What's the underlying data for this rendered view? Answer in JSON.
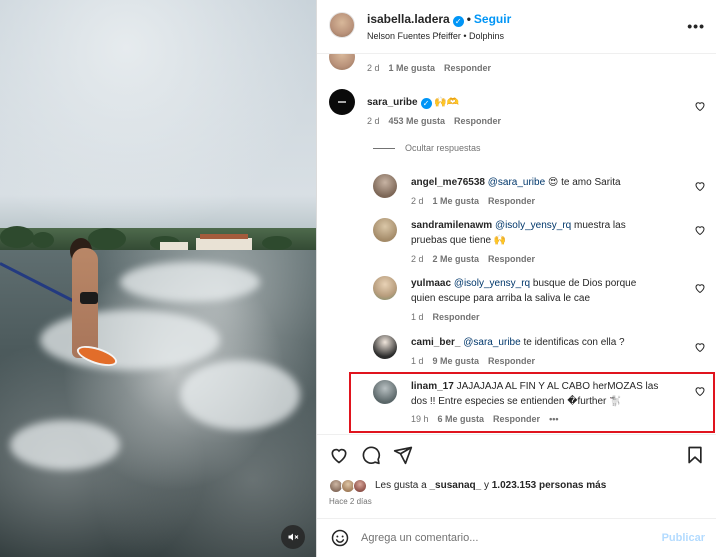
{
  "post": {
    "author": "isabella.ladera",
    "follow_label": "Seguir",
    "audio": "Nelson Fuentes Pfeiffer • Dolphins",
    "more_icon": "•••"
  },
  "comments": [
    {
      "id": "top",
      "user": "",
      "text": "",
      "time": "2 d",
      "likes": "1 Me gusta",
      "reply": "Responder"
    },
    {
      "id": "sara",
      "user": "sara_uribe",
      "text": "🙌🫶",
      "time": "2 d",
      "likes": "453 Me gusta",
      "reply": "Responder"
    }
  ],
  "hide_replies": "Ocultar respuestas",
  "replies": [
    {
      "user": "angel_me76538",
      "mention": "@sara_uribe",
      "text": " 😍 te amo Sarita",
      "text2": "",
      "time": "2 d",
      "likes": "1 Me gusta",
      "reply": "Responder"
    },
    {
      "user": "sandramilenawm",
      "mention": "@isoly_yensy_rq",
      "text": " muestra las",
      "text2": "pruebas que tiene 🙌",
      "time": "2 d",
      "likes": "2 Me gusta",
      "reply": "Responder"
    },
    {
      "user": "yulmaac",
      "mention": "@isoly_yensy_rq",
      "text": " busque de Dios porque",
      "text2": "quien escupe para arriba la saliva le cae",
      "time": "1 d",
      "likes": "",
      "reply": "Responder"
    },
    {
      "user": "cami_ber_",
      "mention": "@sara_uribe",
      "text": " te identificas con ella ?",
      "text2": "",
      "time": "1 d",
      "likes": "9 Me gusta",
      "reply": "Responder"
    },
    {
      "user": "linam_17",
      "mention": "",
      "text": " JAJAJAJA AL FIN Y AL CABO herMOZAS las",
      "text2": "dos !! Entre especies se entienden �further 🐩",
      "time": "19 h",
      "likes": "6 Me gusta",
      "reply": "Responder",
      "more": "•••"
    }
  ],
  "likes_line": {
    "prefix": "Les gusta a ",
    "user": "_susanaq_",
    "middle": " y ",
    "count": "1.023.153 personas más"
  },
  "time_ago": "Hace 2 días",
  "add_comment": {
    "placeholder": "Agrega un comentario...",
    "post_label": "Publicar"
  },
  "colors": {
    "link": "#0095f6",
    "mention": "#00376b",
    "highlight": "#e0141e",
    "muted": "#737373"
  },
  "icons": [
    "heart-icon",
    "comment-icon",
    "share-icon",
    "bookmark-icon",
    "emoji-icon",
    "mute-icon",
    "more-icon",
    "verified-icon"
  ]
}
